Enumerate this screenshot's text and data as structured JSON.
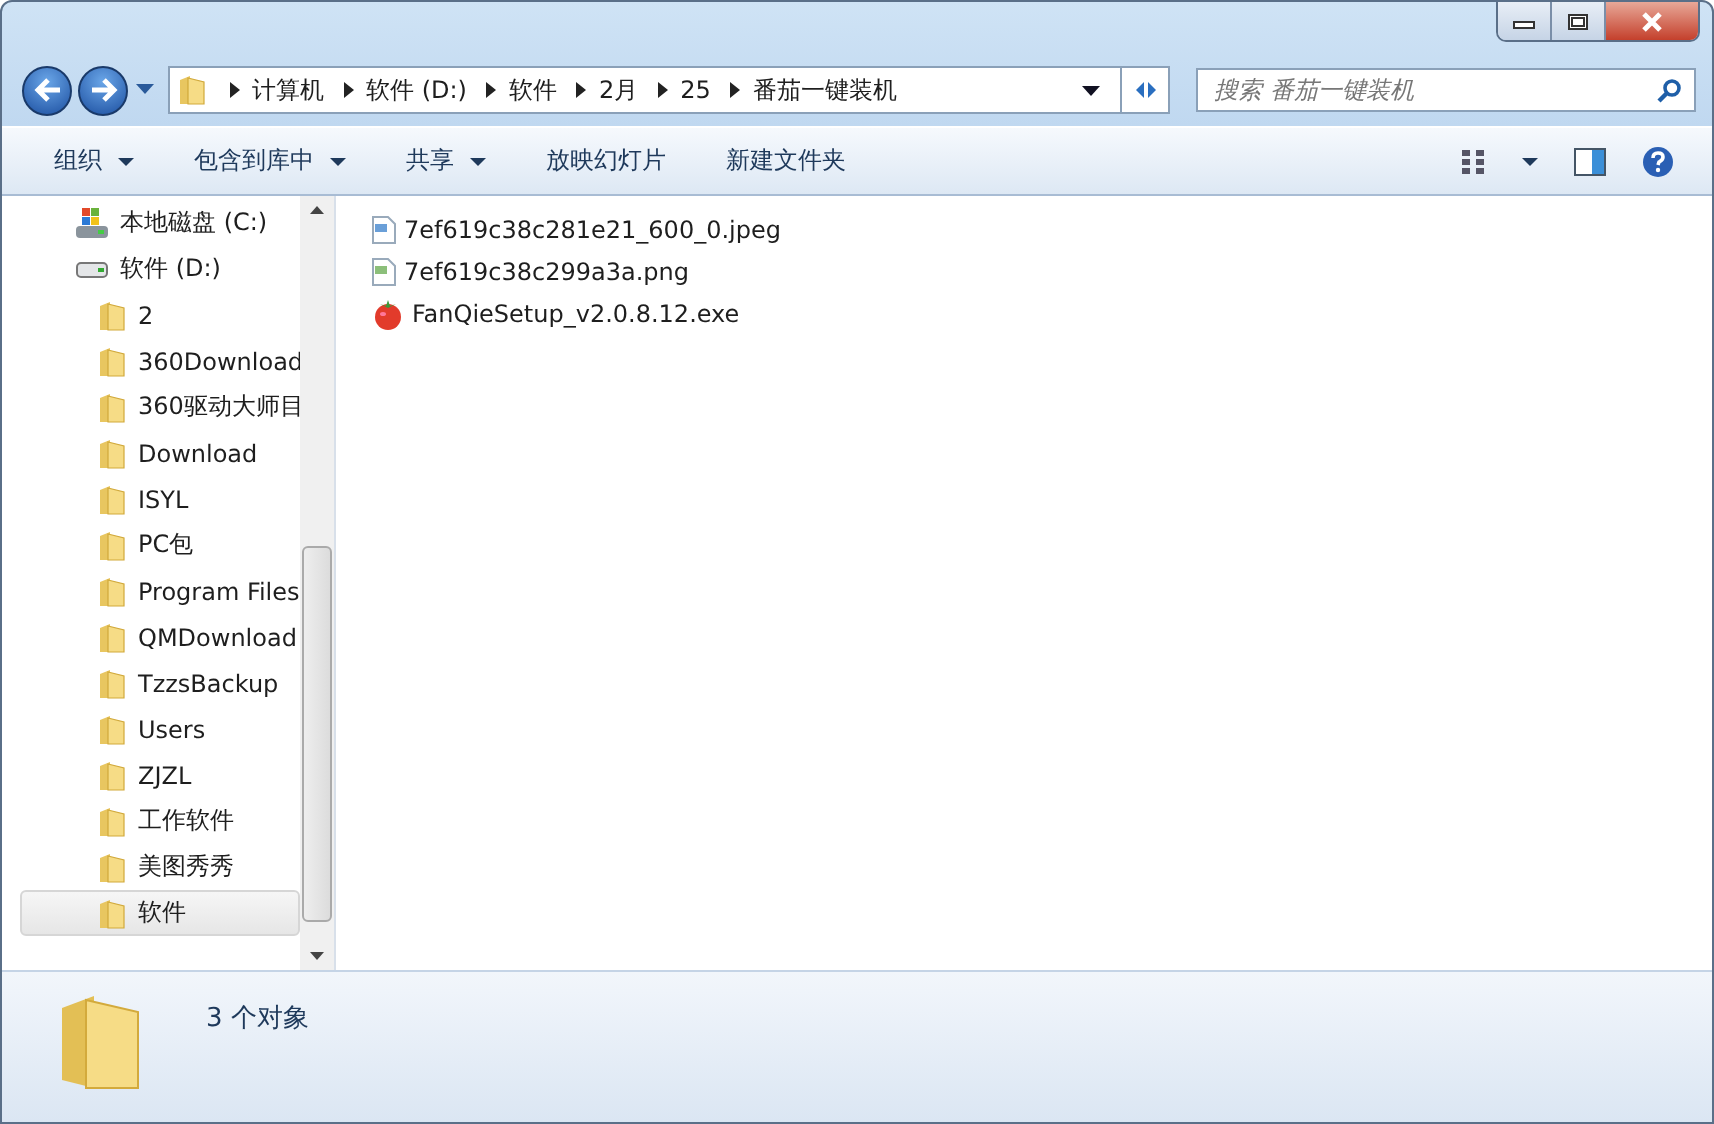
{
  "address_bar": {
    "crumbs": [
      "计算机",
      "软件 (D:)",
      "软件",
      "2月",
      "25",
      "番茄一键装机"
    ]
  },
  "search": {
    "placeholder": "搜索 番茄一键装机"
  },
  "toolbar": {
    "buttons": [
      {
        "label": "组织",
        "dropdown": true
      },
      {
        "label": "包含到库中",
        "dropdown": true
      },
      {
        "label": "共享",
        "dropdown": true
      },
      {
        "label": "放映幻灯片",
        "dropdown": false
      },
      {
        "label": "新建文件夹",
        "dropdown": false
      }
    ]
  },
  "sidebar": {
    "items": [
      {
        "label": "本地磁盘 (C:)",
        "kind": "system-drive",
        "selected": false
      },
      {
        "label": "软件 (D:)",
        "kind": "drive",
        "selected": false,
        "children": [
          {
            "label": "2",
            "kind": "folder",
            "selected": false
          },
          {
            "label": "360Download",
            "kind": "folder",
            "selected": false
          },
          {
            "label": "360驱动大师目",
            "kind": "folder",
            "selected": false
          },
          {
            "label": "Download",
            "kind": "folder",
            "selected": false
          },
          {
            "label": "ISYL",
            "kind": "folder",
            "selected": false
          },
          {
            "label": "PC包",
            "kind": "folder",
            "selected": false
          },
          {
            "label": "Program Files",
            "kind": "folder",
            "selected": false
          },
          {
            "label": "QMDownload",
            "kind": "folder",
            "selected": false
          },
          {
            "label": "TzzsBackup",
            "kind": "folder",
            "selected": false
          },
          {
            "label": "Users",
            "kind": "folder",
            "selected": false
          },
          {
            "label": "ZJZL",
            "kind": "folder",
            "selected": false
          },
          {
            "label": "工作软件",
            "kind": "folder",
            "selected": false
          },
          {
            "label": "美图秀秀",
            "kind": "folder",
            "selected": false
          },
          {
            "label": "软件",
            "kind": "folder",
            "selected": true
          }
        ]
      }
    ]
  },
  "files": [
    {
      "name": "7ef619c38c281e21_600_0.jpeg",
      "kind": "jpeg"
    },
    {
      "name": "7ef619c38c299a3a.png",
      "kind": "png"
    },
    {
      "name": "FanQieSetup_v2.0.8.12.exe",
      "kind": "exe"
    }
  ],
  "status_bar": {
    "text": "3 个对象"
  }
}
